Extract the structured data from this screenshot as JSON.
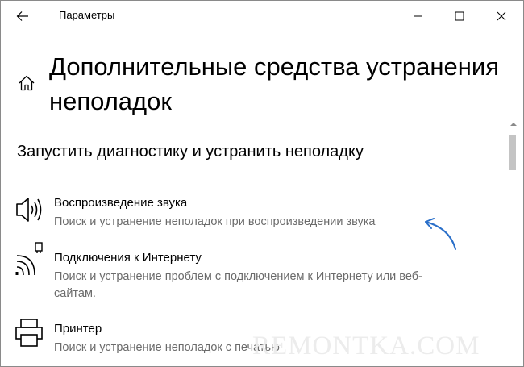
{
  "window": {
    "title": "Параметры"
  },
  "page": {
    "title": "Дополнительные средства устранения неполадок",
    "section_title": "Запустить диагностику и устранить неполадку"
  },
  "items": [
    {
      "title": "Воспроизведение звука",
      "description": "Поиск и устранение неполадок при воспроизведении звука",
      "icon": "speaker-icon"
    },
    {
      "title": "Подключения к Интернету",
      "description": "Поиск и устранение проблем с подключением к Интернету или веб-сайтам.",
      "icon": "network-icon"
    },
    {
      "title": "Принтер",
      "description": "Поиск и устранение неполадок с печатью",
      "icon": "printer-icon"
    }
  ],
  "watermark": "REMONTKA.COM",
  "colors": {
    "accent_arrow": "#2a6fc9",
    "description_text": "#6b6b6b",
    "scroll_thumb": "#c4c4c4"
  }
}
